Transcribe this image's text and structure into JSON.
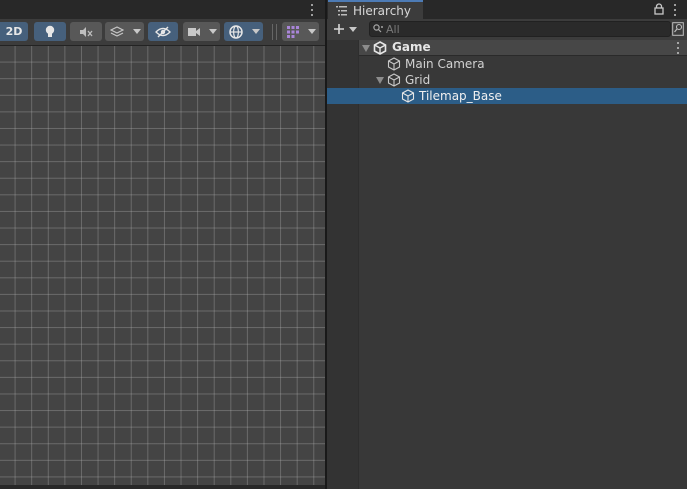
{
  "scene_toolbar": {
    "mode_2d_label": "2D",
    "buttons": [
      {
        "icon": "lightbulb-icon",
        "state": "active"
      },
      {
        "icon": "audio-mute-icon",
        "state": "inactive"
      },
      {
        "icon": "effects-layers-icon",
        "state": "inactive"
      },
      {
        "icon": "visibility-hidden-icon",
        "state": "active"
      },
      {
        "icon": "camera-icon",
        "state": "inactive"
      },
      {
        "icon": "gizmo-globe-icon",
        "state": "active"
      },
      {
        "icon": "grid-snap-icon",
        "state": "inactive"
      }
    ]
  },
  "hierarchy": {
    "tab_label": "Hierarchy",
    "search": {
      "placeholder": "All",
      "value": ""
    },
    "tree": [
      {
        "label": "Game",
        "icon": "unity-scene-icon",
        "depth": 0,
        "expanded": true,
        "selected": false
      },
      {
        "label": "Main Camera",
        "icon": "gameobject-cube-icon",
        "depth": 1,
        "expanded": null,
        "selected": false
      },
      {
        "label": "Grid",
        "icon": "gameobject-cube-icon",
        "depth": 1,
        "expanded": true,
        "selected": false
      },
      {
        "label": "Tilemap_Base",
        "icon": "gameobject-cube-icon",
        "depth": 2,
        "expanded": null,
        "selected": true
      }
    ]
  },
  "colors": {
    "accent_active": "#46607c",
    "selection": "#2c5d87",
    "tab_highlight": "#4d7bb5",
    "panel_bg": "#383838",
    "scene_grid_bg": "#444444"
  }
}
